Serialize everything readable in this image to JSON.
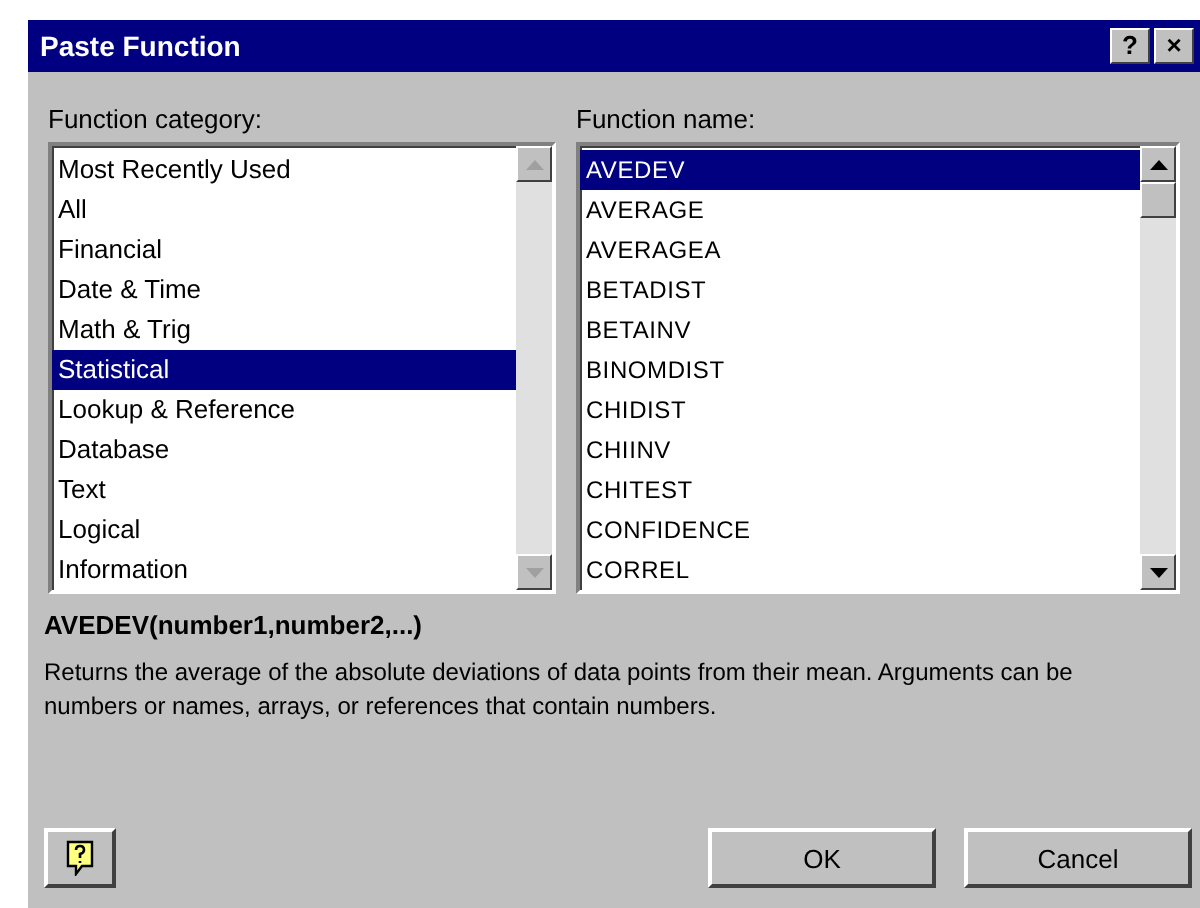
{
  "window": {
    "title": "Paste Function",
    "buttons": [
      "?",
      "×"
    ]
  },
  "category": {
    "label": "Function category:",
    "items": [
      {
        "label": "Most Recently Used",
        "selected": false
      },
      {
        "label": "All",
        "selected": false
      },
      {
        "label": "Financial",
        "selected": false
      },
      {
        "label": "Date & Time",
        "selected": false
      },
      {
        "label": "Math & Trig",
        "selected": false
      },
      {
        "label": "Statistical",
        "selected": true
      },
      {
        "label": "Lookup & Reference",
        "selected": false
      },
      {
        "label": "Database",
        "selected": false
      },
      {
        "label": "Text",
        "selected": false
      },
      {
        "label": "Logical",
        "selected": false
      },
      {
        "label": "Information",
        "selected": false
      }
    ]
  },
  "functions": {
    "label": "Function name:",
    "items": [
      {
        "label": "AVEDEV",
        "selected": true
      },
      {
        "label": "AVERAGE",
        "selected": false
      },
      {
        "label": "AVERAGEA",
        "selected": false
      },
      {
        "label": "BETADIST",
        "selected": false
      },
      {
        "label": "BETAINV",
        "selected": false
      },
      {
        "label": "BINOMDIST",
        "selected": false
      },
      {
        "label": "CHIDIST",
        "selected": false
      },
      {
        "label": "CHIINV",
        "selected": false
      },
      {
        "label": "CHITEST",
        "selected": false
      },
      {
        "label": "CONFIDENCE",
        "selected": false
      },
      {
        "label": "CORREL",
        "selected": false
      }
    ]
  },
  "syntax": "AVEDEV(number1,number2,...)",
  "description": "Returns the average of the absolute deviations of data points from their mean. Arguments can be numbers or names, arrays, or references that contain numbers.",
  "buttons": [
    "OK",
    "Cancel"
  ]
}
